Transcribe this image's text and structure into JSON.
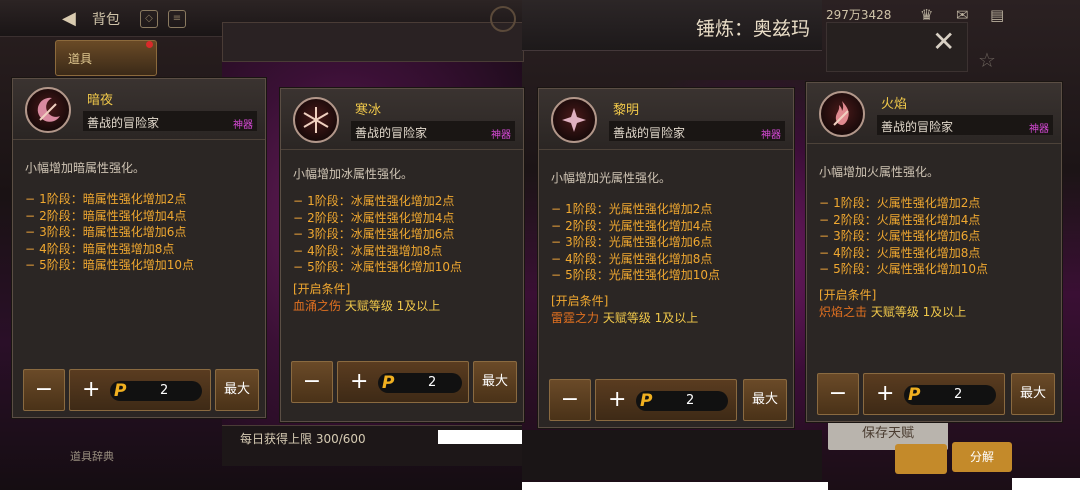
{
  "header": {
    "back_label": "背包",
    "tab_items": "道具",
    "currency": "297万3428",
    "window_title": "锤炼：奥兹玛"
  },
  "footer": {
    "daily_limit": "每日获得上限 300/600",
    "shortcut_label": "道具辞典",
    "save_label": "保存天赋",
    "split_label": "分解"
  },
  "colors": {
    "name": "#f0c84a",
    "level": "#f0a830",
    "rarity": "#d84ad8",
    "condition_skill": "#e07020"
  },
  "cards": [
    {
      "name": "暗夜",
      "owner": "善战的冒险家",
      "rarity": "神器",
      "icon": "dark-crescent-sword-icon",
      "description": "小幅增加暗属性强化。",
      "levels": [
        "1阶段：暗属性强化增加2点",
        "2阶段：暗属性强化增加4点",
        "3阶段：暗属性强化增加6点",
        "4阶段：暗属性强增加8点",
        "5阶段：暗属性强化增加10点"
      ],
      "condition_title": "",
      "condition_skill": "",
      "condition_req": "",
      "minus": "−",
      "plus": "+",
      "p_symbol": "P",
      "points": "2",
      "max_label": "最大"
    },
    {
      "name": "寒冰",
      "owner": "善战的冒险家",
      "rarity": "神器",
      "icon": "snowflake-sword-icon",
      "description": "小幅增加冰属性强化。",
      "levels": [
        "1阶段：冰属性强化增加2点",
        "2阶段：冰属性强化增加4点",
        "3阶段：冰属性强化增加6点",
        "4阶段：冰属性强增加8点",
        "5阶段：冰属性强化增加10点"
      ],
      "condition_title": "[开启条件]",
      "condition_skill": "血涌之伤",
      "condition_req": "天赋等级 1及以上",
      "minus": "−",
      "plus": "+",
      "p_symbol": "P",
      "points": "2",
      "max_label": "最大"
    },
    {
      "name": "黎明",
      "owner": "善战的冒险家",
      "rarity": "神器",
      "icon": "light-star-sword-icon",
      "description": "小幅增加光属性强化。",
      "levels": [
        "1阶段：光属性强化增加2点",
        "2阶段：光属性强化增加4点",
        "3阶段：光属性强化增加6点",
        "4阶段：光属性强化增加8点",
        "5阶段：光属性强化增加10点"
      ],
      "condition_title": "[开启条件]",
      "condition_skill": "雷霆之力",
      "condition_req": "天赋等级 1及以上",
      "minus": "−",
      "plus": "+",
      "p_symbol": "P",
      "points": "2",
      "max_label": "最大"
    },
    {
      "name": "火焰",
      "owner": "善战的冒险家",
      "rarity": "神器",
      "icon": "flame-sword-icon",
      "description": "小幅增加火属性强化。",
      "levels": [
        "1阶段：火属性强化增加2点",
        "2阶段：火属性强化增加4点",
        "3阶段：火属性强化增加6点",
        "4阶段：火属性强化增加8点",
        "5阶段：火属性强化增加10点"
      ],
      "condition_title": "[开启条件]",
      "condition_skill": "炽焰之击",
      "condition_req": "天赋等级 1及以上",
      "minus": "−",
      "plus": "+",
      "p_symbol": "P",
      "points": "2",
      "max_label": "最大"
    }
  ]
}
